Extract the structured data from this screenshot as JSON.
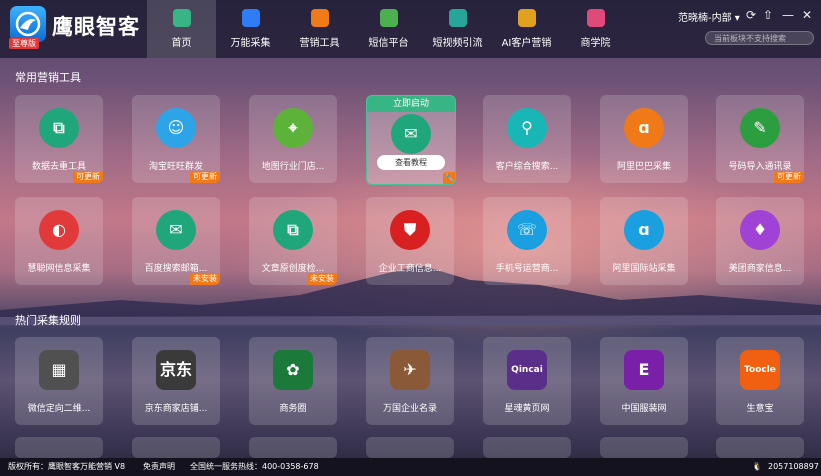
{
  "app": {
    "name": "鹰眼智客",
    "badge": "至尊版"
  },
  "nav": [
    {
      "label": "首页",
      "color": "#37b585",
      "icon": "home-icon"
    },
    {
      "label": "万能采集",
      "color": "#2f7cf6",
      "icon": "clipboard-icon"
    },
    {
      "label": "营销工具",
      "color": "#f07a18",
      "icon": "briefcase-icon"
    },
    {
      "label": "短信平台",
      "color": "#4caf50",
      "icon": "sms-icon"
    },
    {
      "label": "短视频引流",
      "color": "#26a69a",
      "icon": "video-icon"
    },
    {
      "label": "AI客户营销",
      "color": "#e0a020",
      "icon": "ai-icon"
    },
    {
      "label": "商学院",
      "color": "#e04a7a",
      "icon": "graduation-icon"
    }
  ],
  "user": {
    "name": "范晓楠-内部"
  },
  "search": {
    "placeholder": "当前板块不支持搜索"
  },
  "sections": {
    "tools": "常用营销工具",
    "rules": "热门采集规则"
  },
  "tools_row1": [
    {
      "label": "数据去重工具",
      "tag": "可更新",
      "color": "#1fa67a",
      "glyph": "⧉"
    },
    {
      "label": "淘宝旺旺群发",
      "tag": "可更新",
      "color": "#2ea4e8",
      "glyph": "☺"
    },
    {
      "label": "地图行业门店...",
      "tag": "",
      "color": "#5db33a",
      "glyph": "⌖"
    },
    {
      "label": "",
      "tag": "",
      "color": "#1fa67a",
      "glyph": "✉"
    },
    {
      "label": "客户综合搜索...",
      "tag": "",
      "color": "#19b6b6",
      "glyph": "⚲"
    },
    {
      "label": "阿里巴巴采集",
      "tag": "",
      "color": "#f07a18",
      "glyph": "ɑ"
    },
    {
      "label": "号码导入通讯录",
      "tag": "可更新",
      "color": "#2b9e3f",
      "glyph": "✎"
    }
  ],
  "hover_card": {
    "launch": "立即启动",
    "tutorial": "查看教程"
  },
  "tools_row2": [
    {
      "label": "慧聪网信息采集",
      "tag": "",
      "color": "#e23a3a",
      "glyph": "◐"
    },
    {
      "label": "百度搜索邮箱...",
      "tag": "未安装",
      "color": "#1fa67a",
      "glyph": "✉"
    },
    {
      "label": "文章原创度检...",
      "tag": "未安装",
      "color": "#1fa67a",
      "glyph": "⧉"
    },
    {
      "label": "企业工商信息...",
      "tag": "",
      "color": "#d92020",
      "glyph": "⛊"
    },
    {
      "label": "手机号运营商...",
      "tag": "",
      "color": "#1a9fe0",
      "glyph": "☏"
    },
    {
      "label": "阿里国际站采集",
      "tag": "",
      "color": "#1a9fe0",
      "glyph": "ɑ"
    },
    {
      "label": "美团商家信息...",
      "tag": "",
      "color": "#a142d6",
      "glyph": "♦"
    }
  ],
  "rules_row": [
    {
      "label": "微信定向二维...",
      "color": "#505050",
      "glyph": "▦"
    },
    {
      "label": "京东商家店铺...",
      "color": "#3a3a3a",
      "glyph": "京东"
    },
    {
      "label": "商务圈",
      "color": "#1b7a3a",
      "glyph": "✿"
    },
    {
      "label": "万国企业名录",
      "color": "#8a5a38",
      "glyph": "✈"
    },
    {
      "label": "星魂黄页网",
      "color": "#5a2f8a",
      "glyph": "Qincai"
    },
    {
      "label": "中国服装网",
      "color": "#7a1fa8",
      "glyph": "E"
    },
    {
      "label": "生意宝",
      "color": "#f06010",
      "glyph": "Toocle"
    }
  ],
  "footer": {
    "copyright": "版权所有：鹰眼智客万能营销 V8",
    "disclaimer": "免责声明",
    "hotline": "全国统一服务热线：400-0358-678",
    "qq": "2057108897"
  }
}
